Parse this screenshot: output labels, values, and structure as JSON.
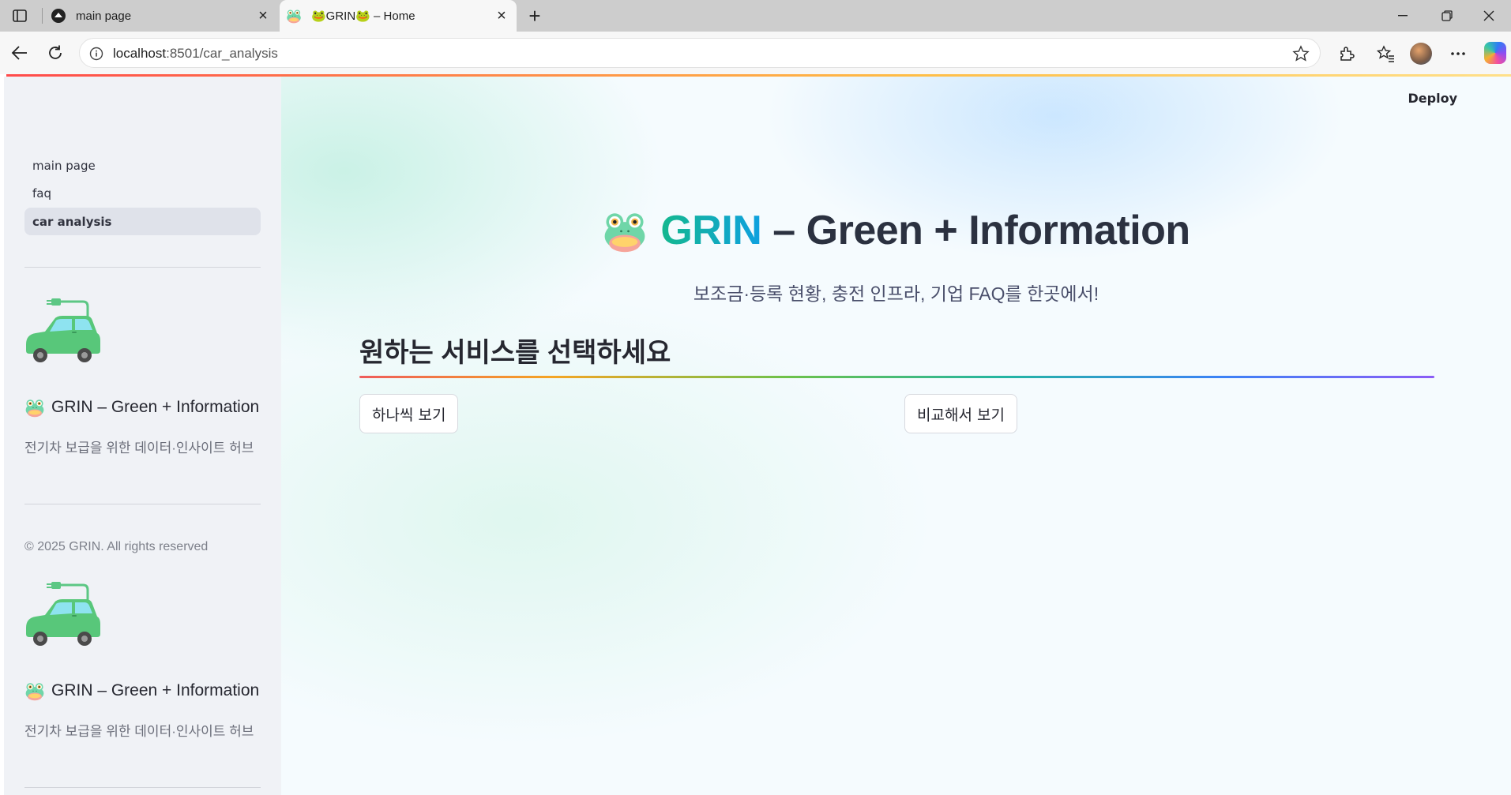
{
  "browser": {
    "tabs": [
      {
        "title": "main page",
        "active": false
      },
      {
        "title": "🐸GRIN🐸 – Home",
        "active": true
      }
    ],
    "url_host": "localhost",
    "url_rest": ":8501/car_analysis"
  },
  "app": {
    "deploy_label": "Deploy",
    "sidebar": {
      "nav": [
        {
          "label": "main page",
          "active": false
        },
        {
          "label": "faq",
          "active": false
        },
        {
          "label": "car analysis",
          "active": true
        }
      ],
      "brand_title": "GRIN – Green + Information",
      "brand_subtitle": "전기차 보급을 위한 데이터·인사이트 허브",
      "copyright": "© 2025 GRIN. All rights reserved"
    },
    "hero": {
      "title_accent": "GRIN",
      "title_rest": "– Green + Information",
      "subtitle": "보조금·등록 현황, 충전 인프라, 기업 FAQ를 한곳에서!"
    },
    "section_heading": "원하는 서비스를 선택하세요",
    "buttons": {
      "single_view": "하나씩 보기",
      "compare_view": "비교해서 보기"
    }
  },
  "colors": {
    "accent_start": "#15b88e",
    "accent_end": "#0ea0e0",
    "sidebar_bg": "#f0f2f6"
  }
}
